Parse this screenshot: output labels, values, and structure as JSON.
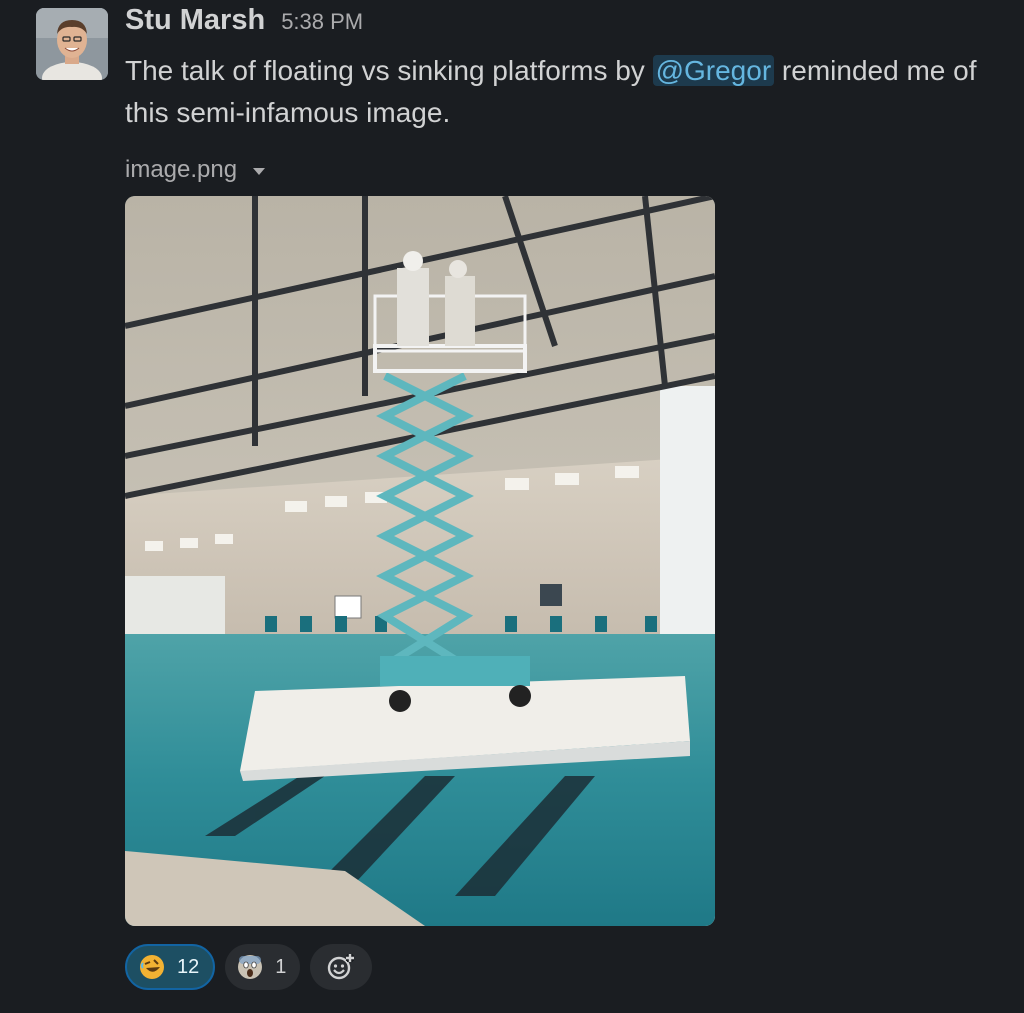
{
  "message": {
    "sender": "Stu Marsh",
    "timestamp": "5:38 PM",
    "text_before": "The talk of floating vs sinking platforms by ",
    "mention": "@Gregor",
    "text_after": " reminded me of this semi-infamous image.",
    "attachment": {
      "filename": "image.png"
    },
    "reactions": [
      {
        "emoji": "rolling-on-floor-laughing",
        "count": "12",
        "active": true
      },
      {
        "emoji": "face-screaming-in-fear",
        "count": "1",
        "active": false
      }
    ]
  },
  "colors": {
    "background": "#1a1d21",
    "mention_bg": "#1d3a4d",
    "mention_text": "#65b6e0",
    "active_reaction_bg": "#1d4f63",
    "active_reaction_border": "#1264a3"
  },
  "icons": {
    "attachment_menu": "chevron-down-icon",
    "add_reaction": "add-reaction-icon"
  }
}
